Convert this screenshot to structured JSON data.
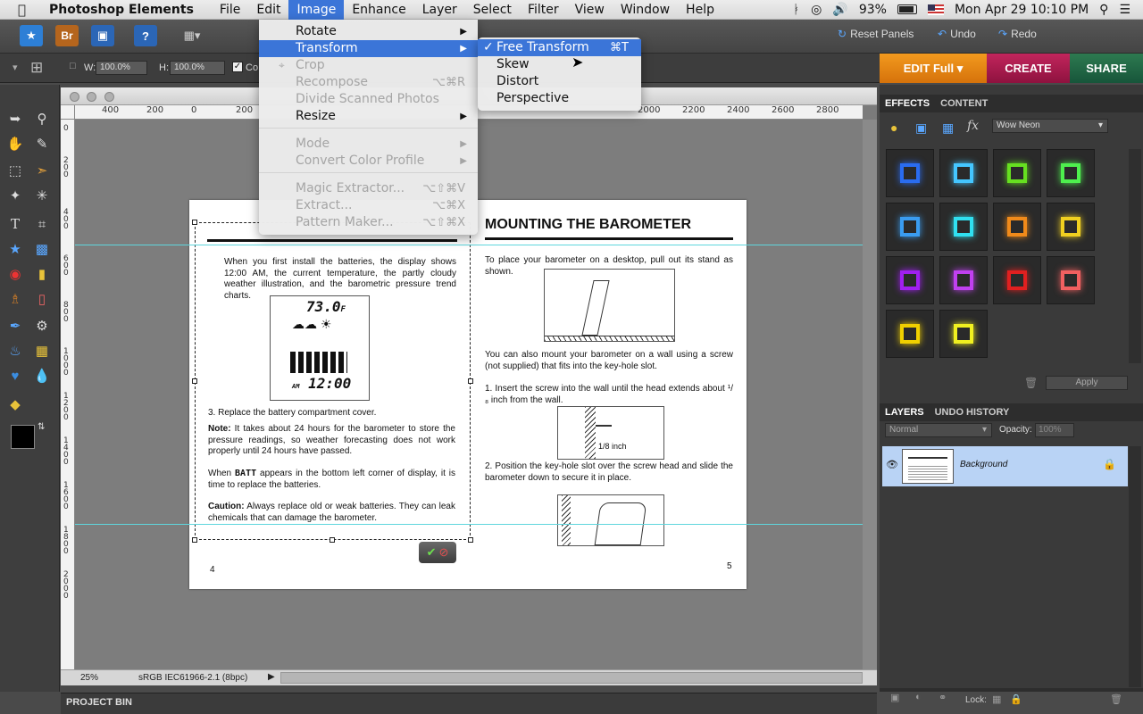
{
  "system_menu": {
    "app_name": "Photoshop Elements",
    "items": [
      "File",
      "Edit",
      "Image",
      "Enhance",
      "Layer",
      "Select",
      "Filter",
      "View",
      "Window",
      "Help"
    ],
    "active_item": "Image",
    "battery": "93%",
    "datetime": "Mon Apr 29  10:10 PM"
  },
  "toolbar": {
    "bridge_label": "Br",
    "help_label": "?",
    "reset_panels": "Reset Panels",
    "undo": "Undo",
    "redo": "Redo"
  },
  "tool_options": {
    "w_label": "W:",
    "w_value": "100.0%",
    "h_label": "H:",
    "h_value": "100.0%",
    "constrain_label": "Co"
  },
  "mode_tabs": {
    "edit": "EDIT Full",
    "create": "CREATE",
    "share": "SHARE"
  },
  "image_menu": [
    {
      "label": "Rotate",
      "submenu": true,
      "disabled": false
    },
    {
      "label": "Transform",
      "submenu": true,
      "disabled": false,
      "highlighted": true
    },
    {
      "label": "Crop",
      "disabled": true
    },
    {
      "label": "Recompose",
      "shortcut": "⌥⌘R",
      "disabled": true
    },
    {
      "label": "Divide Scanned Photos",
      "disabled": true
    },
    {
      "label": "Resize",
      "submenu": true,
      "disabled": false
    },
    {
      "label": "Mode",
      "submenu": true,
      "disabled": true
    },
    {
      "label": "Convert Color Profile",
      "submenu": true,
      "disabled": true
    },
    {
      "label": "Magic Extractor...",
      "shortcut": "⌥⇧⌘V",
      "disabled": true
    },
    {
      "label": "Extract...",
      "shortcut": "⌥⌘X",
      "disabled": true
    },
    {
      "label": "Pattern Maker...",
      "shortcut": "⌥⇧⌘X",
      "disabled": true
    }
  ],
  "transform_submenu": [
    {
      "label": "Free Transform",
      "shortcut": "⌘T",
      "checked": true,
      "highlighted": true
    },
    {
      "label": "Skew"
    },
    {
      "label": "Distort"
    },
    {
      "label": "Perspective"
    }
  ],
  "document": {
    "ruler_top_ticks": [
      "400",
      "200",
      "0",
      "200",
      "2000",
      "2200",
      "2400",
      "2600",
      "2800"
    ],
    "ruler_left_ticks": [
      "0",
      "200",
      "400",
      "600",
      "800",
      "1000",
      "1200",
      "1400",
      "1600",
      "1800",
      "2000"
    ],
    "zoom": "25%",
    "color_profile": "sRGB IEC61966-2.1 (8bpc)",
    "left_page": {
      "para1": "When you first install the batteries, the display shows 12:00 AM, the current temperature, the partly cloudy weather illustration, and the barometric pressure trend charts.",
      "lcd_temp": "73.0",
      "lcd_temp_unit": "F",
      "lcd_time": "12:00",
      "lcd_ampm": "AM",
      "step3": "3.   Replace the battery compartment cover.",
      "note_label": "Note:",
      "note_text": " It takes about 24 hours for the barometer to store the pressure readings, so weather forecasting does not work properly until 24 hours have passed.",
      "batt_pre": "When ",
      "batt_word": "BATT",
      "batt_post": " appears in the bottom left corner of display, it is time to replace the batteries.",
      "caution_label": "Caution:",
      "caution_text": " Always replace old or weak batteries.  They can leak chemicals that can damage the barometer.",
      "page_no": "4"
    },
    "right_page": {
      "heading": "MOUNTING THE BAROMETER",
      "para1": "To place your barometer on a desktop, pull out its stand as shown.",
      "para2": "You can also mount your barometer on a wall using a screw (not supplied) that fits into the key-hole slot.",
      "step1": "1.   Insert the screw into the wall until the head extends about ¹/₈ inch from the wall.",
      "figure_label": "1/8 inch",
      "step2": "2.   Position the key-hole slot over the screw head and slide the barometer down to secure it in place.",
      "page_no": "5"
    }
  },
  "effects_panel": {
    "tabs": [
      "EFFECTS",
      "CONTENT"
    ],
    "style_select": "Wow Neon",
    "apply": "Apply",
    "swatches": [
      "#2a6cf0",
      "#44c6ff",
      "#66e020",
      "#4ef04e",
      "#3a9cf0",
      "#30e0f0",
      "#f08a1a",
      "#f0d020",
      "#a020f0",
      "#c040f0",
      "#e02020",
      "#f06060",
      "#f0d000",
      "#f0f020"
    ]
  },
  "layers_panel": {
    "tabs": [
      "LAYERS",
      "UNDO HISTORY"
    ],
    "blend_mode": "Normal",
    "opacity_label": "Opacity:",
    "opacity_value": "100%",
    "layer_name": "Background",
    "lock_label": "Lock:"
  },
  "project_bin": "PROJECT BIN"
}
